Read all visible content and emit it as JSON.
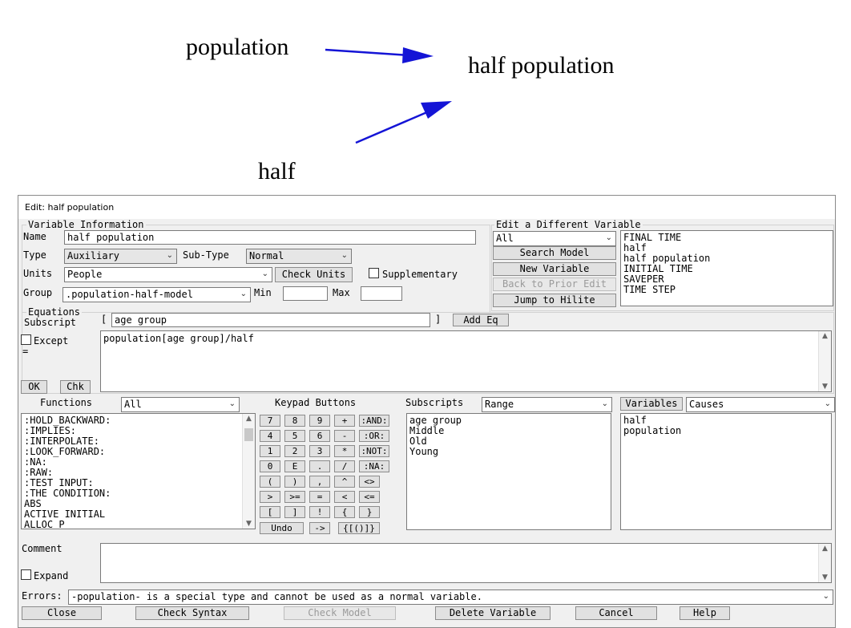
{
  "diagram": {
    "nodes": {
      "population": "population",
      "half_population": "half population",
      "half": "half"
    },
    "arrow_color": "#1414d6"
  },
  "dialog": {
    "title": "Edit: half population",
    "var_info": {
      "group_label": "Variable Information",
      "name_label": "Name",
      "name_value": "half population",
      "type_label": "Type",
      "type_value": "Auxiliary",
      "subtype_label": "Sub-Type",
      "subtype_value": "Normal",
      "units_label": "Units",
      "units_value": "People",
      "check_units": "Check Units",
      "supplementary_label": "Supplementary",
      "group_field_label": "Group",
      "group_value": ".population-half-model",
      "min_label": "Min",
      "min_value": "",
      "max_label": "Max",
      "max_value": ""
    },
    "edit_different": {
      "group_label": "Edit a Different Variable",
      "filter_value": "All",
      "search_model": "Search Model",
      "new_variable": "New Variable",
      "back_to_prior": "Back to Prior Edit",
      "jump_to_hilite": "Jump to Hilite",
      "variables": [
        "FINAL TIME",
        "half",
        "half population",
        "INITIAL TIME",
        "SAVEPER",
        "TIME STEP"
      ]
    },
    "equations": {
      "group_label": "Equations",
      "subscript_label": "Subscript",
      "bracket_open": "[",
      "subscript_value": "age group",
      "bracket_close": "]",
      "add_eq": "Add Eq",
      "except_label": "Except",
      "equals": "=",
      "equation_text": "population[age group]/half",
      "ok": "OK",
      "chk": "Chk"
    },
    "functions": {
      "label": "Functions",
      "filter_value": "All",
      "items": [
        ":HOLD_BACKWARD:",
        ":IMPLIES:",
        ":INTERPOLATE:",
        ":LOOK_FORWARD:",
        ":NA:",
        ":RAW:",
        ":TEST INPUT:",
        ":THE CONDITION:",
        "ABS",
        "ACTIVE INITIAL",
        "ALLOC P"
      ]
    },
    "keypad": {
      "label": "Keypad Buttons",
      "rows": [
        [
          "7",
          "8",
          "9",
          "+",
          ":AND:"
        ],
        [
          "4",
          "5",
          "6",
          "-",
          ":OR:"
        ],
        [
          "1",
          "2",
          "3",
          "*",
          ":NOT:"
        ],
        [
          "0",
          "E",
          ".",
          "/",
          ":NA:"
        ],
        [
          "(",
          ")",
          ",",
          "^",
          "<>"
        ],
        [
          ">",
          ">=",
          "=",
          "<",
          "<="
        ],
        [
          "[",
          "]",
          "!",
          "{",
          "}"
        ]
      ],
      "undo": "Undo",
      "arrow": "->",
      "brackets": "{[()]}"
    },
    "subscripts": {
      "label": "Subscripts",
      "filter_value": "Range",
      "items": [
        "age group",
        "Middle",
        "Old",
        "Young"
      ]
    },
    "variables_panel": {
      "button_label": "Variables",
      "filter_value": "Causes",
      "items": [
        "half",
        "population"
      ]
    },
    "comment": {
      "label": "Comment",
      "value": "",
      "expand_label": "Expand"
    },
    "errors": {
      "label": "Errors:",
      "message": "-population- is a special type and cannot be used as a normal variable."
    },
    "bottom_buttons": {
      "close": "Close",
      "check_syntax": "Check Syntax",
      "check_model": "Check Model",
      "delete_variable": "Delete Variable",
      "cancel": "Cancel",
      "help": "Help"
    }
  }
}
